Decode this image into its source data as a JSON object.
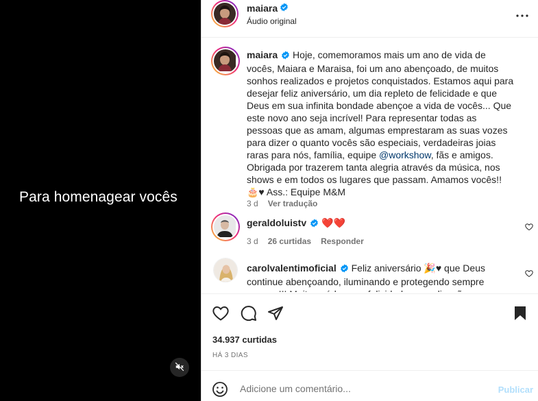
{
  "video": {
    "caption": "Para homenagear vocês",
    "mute_icon": "speaker-muted-icon"
  },
  "header": {
    "username": "maiara",
    "subtitle": "Áudio original",
    "more_icon": "more-horizontal-icon"
  },
  "caption_post": {
    "username": "maiara",
    "text_before_mention": "Hoje, comemoramos mais um ano de vida de vocês, Maiara e Maraisa, foi um ano abençoado, de muitos sonhos realizados e projetos conquistados. Estamos aqui para desejar feliz aniversário, um dia repleto de felicidade e que Deus em sua infinita bondade abençoe a vida de vocês... Que este novo ano seja incrível! Para representar todas as pessoas que as amam, algumas emprestaram as suas vozes para dizer o quanto vocês são especiais, verdadeiras joias raras para nós, família, equipe ",
    "mention": "@workshow",
    "text_after_mention": ", fãs e amigos. Obrigada por trazerem tanta alegria através da música, nos shows e em todos os lugares que passam. Amamos vocês!! 🎂♥ Ass.: Equipe M&M",
    "time": "3 d",
    "see_translation": "Ver tradução"
  },
  "comments": [
    {
      "username": "geraldoluistv",
      "text": "❤️❤️",
      "time": "3 d",
      "likes": "26 curtidas",
      "reply": "Responder"
    },
    {
      "username": "carolvalentimoficial",
      "text": "Feliz aniversário 🎉♥ que Deus continue abençoando, iluminando e protegendo sempre sempre!!! Muita saúde, paz, felicidades e realizações nessa"
    }
  ],
  "actions": {
    "like_icon": "heart-icon",
    "comment_icon": "comment-icon",
    "share_icon": "send-icon",
    "save_icon": "bookmark-icon"
  },
  "likes": {
    "count": "34.937",
    "label": "curtidas"
  },
  "date": "HÁ 3 DIAS",
  "add_comment": {
    "placeholder": "Adicione um comentário...",
    "publish": "Publicar",
    "emoji_icon": "emoji-icon"
  },
  "colors": {
    "verified": "#0095f6",
    "link": "#00376b",
    "publish_disabled": "#b2dffc",
    "heart": "#ed4956"
  }
}
